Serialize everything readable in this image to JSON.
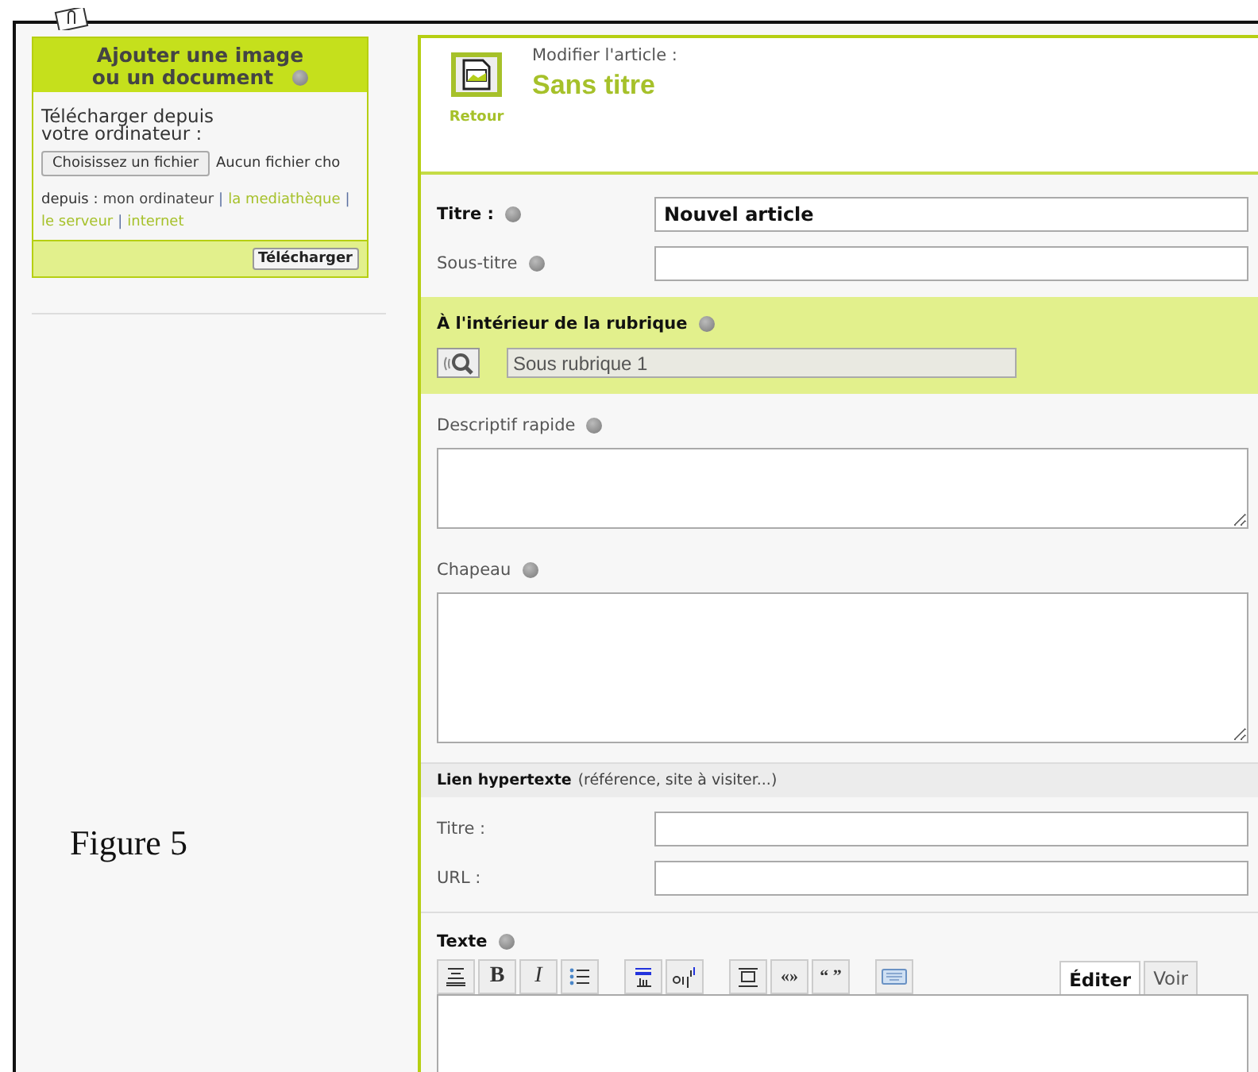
{
  "upload_panel": {
    "title_line_1": "Ajouter une image",
    "title_line_2": "ou un document",
    "intro": "Télécharger depuis votre ordinateur :",
    "file_button": "Choisissez un fichier",
    "file_status": "Aucun fichier cho",
    "sources_label": "depuis :",
    "sources": [
      {
        "label": "mon ordinateur",
        "selected": true
      },
      {
        "separator": "|",
        "label": "la mediathèque",
        "selected": false
      },
      {
        "separator": "|",
        "label": "le serveur",
        "selected": false
      },
      {
        "separator": "|",
        "label": "internet",
        "selected": false
      }
    ],
    "submit": "Télécharger"
  },
  "caption": "Figure 5",
  "header": {
    "back": "Retour",
    "subtitle": "Modifier l'article :",
    "title": "Sans titre"
  },
  "fields": [
    {
      "label": "Titre :",
      "bold": true,
      "help": true,
      "value": "Nouvel article"
    },
    {
      "label": "Sous-titre",
      "bold": false,
      "help": true
    }
  ],
  "rubrique": {
    "label": "À l'intérieur de la rubrique",
    "value": "Sous rubrique 1"
  },
  "descriptif": {
    "label": "Descriptif rapide"
  },
  "chapeau": {
    "label": "Chapeau"
  },
  "lien": {
    "title": "Lien hypertexte",
    "note": "(référence, site à visiter...)",
    "fields": [
      {
        "label": "Titre :"
      },
      {
        "label": "URL :"
      }
    ]
  },
  "texte": {
    "label": "Texte",
    "toolbar": [
      {
        "kind": "heading"
      },
      {
        "kind": "bold",
        "label": "B"
      },
      {
        "kind": "italic",
        "label": "I"
      },
      {
        "kind": "list"
      },
      {
        "kind": "gap"
      },
      {
        "kind": "spip"
      },
      {
        "kind": "note"
      },
      {
        "kind": "gap"
      },
      {
        "kind": "block"
      },
      {
        "kind": "quote",
        "label": "«»"
      },
      {
        "kind": "quote",
        "label": "“ ”"
      },
      {
        "kind": "gap"
      },
      {
        "kind": "keyboard"
      }
    ],
    "tabs": [
      {
        "label": "Éditer",
        "selected": true
      },
      {
        "label": "Voir",
        "selected": false
      }
    ]
  }
}
